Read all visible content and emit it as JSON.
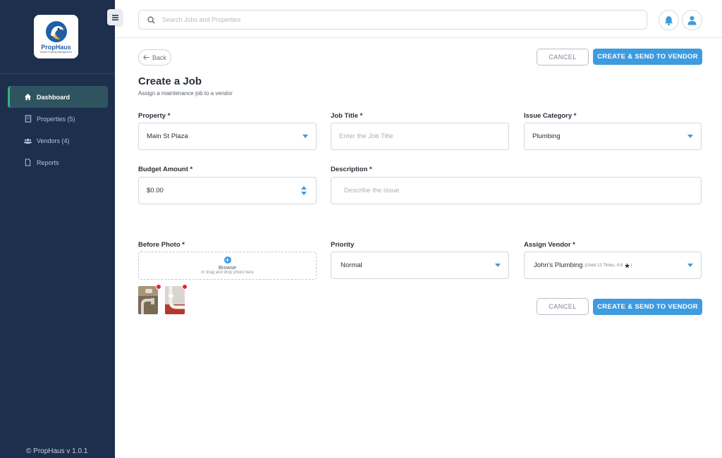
{
  "app": {
    "logo_name": "PropHaus",
    "logo_tagline": "Smart Property Management",
    "footer": "© PropHaus v 1.0.1"
  },
  "sidebar": {
    "items": [
      {
        "label": "Dashboard",
        "icon": "home-icon",
        "active": true
      },
      {
        "label": "Properties (5)",
        "icon": "building-icon",
        "active": false
      },
      {
        "label": "Vendors (4)",
        "icon": "users-icon",
        "active": false
      },
      {
        "label": "Reports",
        "icon": "document-icon",
        "active": false
      }
    ]
  },
  "header": {
    "search_placeholder": "Search Jobs and Properties",
    "icons": [
      "menu-icon",
      "search-icon",
      "bell-icon",
      "user-icon"
    ]
  },
  "actions": {
    "back_label": "Back",
    "cancel_label": "CANCEL",
    "primary_label": "CREATE & SEND TO VENDOR"
  },
  "page": {
    "title": "Create a Job",
    "subtitle": "Assign a maintenance job to a vendor"
  },
  "form": {
    "property": {
      "label": "Property *",
      "value": "Main St Plaza"
    },
    "job_title": {
      "label": "Job Title *",
      "placeholder": "Enter the Job Title"
    },
    "issue_category": {
      "label": "Issue Category *",
      "value": "Plumbing"
    },
    "budget": {
      "label": "Budget Amount *",
      "value": "$0.00"
    },
    "description": {
      "label": "Description *",
      "placeholder": "Describe the issue"
    },
    "before_photo": {
      "label": "Before Photo *",
      "browse": "Browse",
      "hint": "or drag and drop photo here",
      "photos": [
        "sink-pipe-photo-1",
        "sink-pipe-photo-2"
      ]
    },
    "priority": {
      "label": "Priority",
      "value": "Normal"
    },
    "vendor": {
      "label": "Assign Vendor *",
      "value": "John's Plumbing",
      "meta": "(Used 12 Times, 4.8"
    }
  },
  "colors": {
    "sidebar_bg": "#1e2f4d",
    "accent": "#3d9be0",
    "active_indicator": "#2db87d",
    "remove_badge": "#e0262a"
  }
}
